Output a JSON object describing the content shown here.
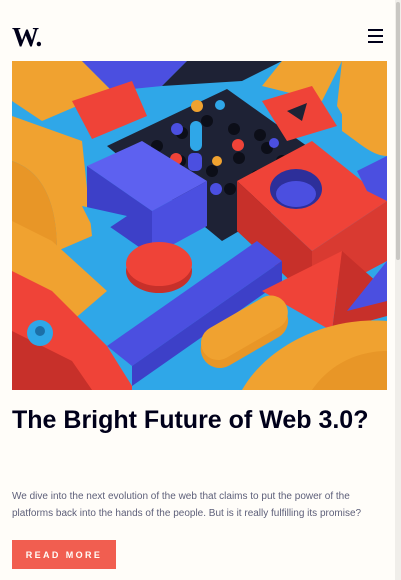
{
  "header": {
    "logo": "W.",
    "menu_icon": "hamburger-menu-icon"
  },
  "hero": {
    "image": "colorful-3d-abstract-blocks",
    "colors": {
      "blue": "#4b4fe0",
      "sky": "#2fa7e8",
      "orange": "#f0a230",
      "red": "#ef4338",
      "navy": "#1e2235"
    }
  },
  "article": {
    "title": "The Bright Future of Web 3.0?",
    "description": "We dive into the next evolution of the web that claims to put the power of the platforms back into the hands of the people. But is it really fulfilling its promise?",
    "cta_label": "READ MORE"
  }
}
